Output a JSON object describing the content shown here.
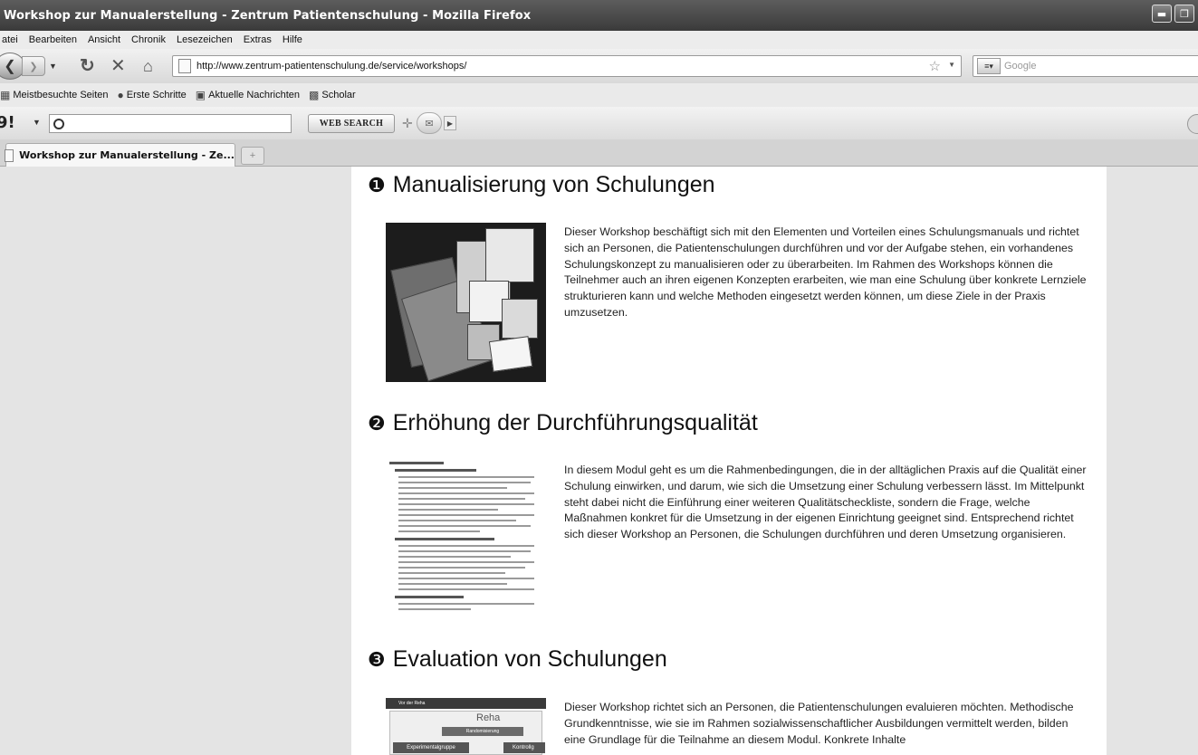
{
  "window": {
    "title": "Workshop zur Manualerstellung - Zentrum Patientenschulung - Mozilla Firefox",
    "minimize_icon": "minimize-icon",
    "restore_icon": "restore-icon"
  },
  "menu": {
    "items": [
      "atei",
      "Bearbeiten",
      "Ansicht",
      "Chronik",
      "Lesezeichen",
      "Extras",
      "Hilfe"
    ]
  },
  "nav": {
    "url": "http://www.zentrum-patientenschulung.de/service/workshops/",
    "search_placeholder": "Google",
    "back_icon": "back-arrow-icon",
    "forward_icon": "forward-arrow-icon",
    "reload_icon": "reload-icon",
    "stop_icon": "stop-icon",
    "home_icon": "home-icon",
    "bookmark_star_icon": "star-icon"
  },
  "bookmarks": {
    "items": [
      {
        "label": "Meistbesuchte Seiten",
        "icon": "folder-icon"
      },
      {
        "label": "Erste Schritte",
        "icon": "firefox-icon"
      },
      {
        "label": "Aktuelle Nachrichten",
        "icon": "rss-icon"
      },
      {
        "label": "Scholar",
        "icon": "scholar-icon"
      }
    ]
  },
  "yahoo_toolbar": {
    "logo": "9!",
    "search_button": "WEB SEARCH"
  },
  "tabs": {
    "active_label": "Workshop zur Manualerstellung - Ze...",
    "new_tab_symbol": "+"
  },
  "sections": [
    {
      "number": "❶",
      "title": "Manualisierung von Schulungen",
      "text": "Dieser Workshop beschäftigt sich mit den Elementen und Vorteilen eines Schulungsmanuals und richtet sich an Personen, die Patientenschulungen durchführen und vor der Aufgabe stehen, ein vorhandenes Schulungskonzept zu manualisieren oder zu überarbeiten. Im Rahmen des Workshops können die Teilnehmer auch an ihren eigenen Konzepten erarbeiten, wie man eine Schulung über konkrete Lernziele strukturieren kann und welche Methoden eingesetzt werden können, um diese Ziele in der Praxis umzusetzen."
    },
    {
      "number": "❷",
      "title": "Erhöhung der Durchführungsqualität",
      "text": "In diesem Modul geht es um die Rahmenbedingungen, die in der alltäglichen Praxis auf die Qualität einer Schulung einwirken, und darum, wie sich die Umsetzung einer Schulung verbessern lässt. Im Mittelpunkt steht dabei nicht die Einführung einer weiteren Qualitätscheckliste, sondern die Frage, welche Maßnahmen konkret für die Umsetzung in der eigenen Einrichtung geeignet sind. Entsprechend richtet sich dieser Workshop an Personen, die Schulungen durchführen und deren Umsetzung organisieren."
    },
    {
      "number": "❸",
      "title": "Evaluation von Schulungen",
      "text": "Dieser Workshop richtet sich an Personen, die Patientenschulungen evaluieren möchten. Methodische Grundkenntnisse, wie sie im Rahmen sozialwissenschaftlicher Ausbildungen vermittelt werden, bilden eine Grundlage für die Teilnahme an diesem Modul. Konkrete Inhalte"
    }
  ],
  "thumb3": {
    "header": "Vor der Reha",
    "title": "Reha",
    "box": "Randomisierung",
    "left": "Experimentalgruppe",
    "right": "Kontrollg"
  }
}
